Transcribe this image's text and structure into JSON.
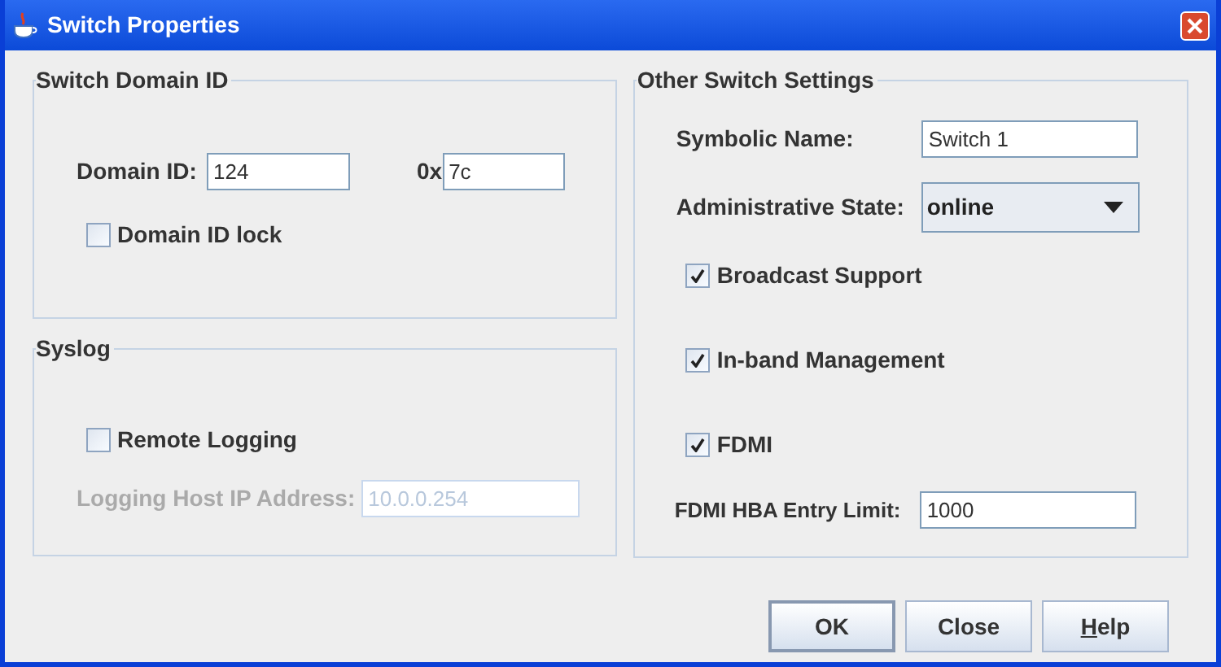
{
  "window": {
    "title": "Switch Properties"
  },
  "domain_group": {
    "title": "Switch Domain ID",
    "domain_id_label": "Domain ID:",
    "domain_id": "124",
    "hex_label": "0x",
    "hex_value": "7c",
    "lock": {
      "label": "Domain ID lock",
      "checked": false
    }
  },
  "syslog_group": {
    "title": "Syslog",
    "remote_logging": {
      "label": "Remote Logging",
      "checked": false
    },
    "host_label": "Logging Host IP Address:",
    "host_value": "10.0.0.254",
    "host_disabled": true
  },
  "other_group": {
    "title": "Other Switch Settings",
    "symbolic_name_label": "Symbolic Name:",
    "symbolic_name": "Switch 1",
    "admin_state_label": "Administrative State:",
    "admin_state": "online",
    "options": [
      {
        "label": "Broadcast Support",
        "checked": true
      },
      {
        "label": "In-band Management",
        "checked": true
      },
      {
        "label": "FDMI",
        "checked": true
      }
    ],
    "fdmi_limit_label": "FDMI HBA Entry Limit:",
    "fdmi_limit": "1000"
  },
  "buttons": [
    {
      "label": "OK",
      "default": true,
      "mnemonic": false
    },
    {
      "label": "Close",
      "default": false,
      "mnemonic": false
    },
    {
      "label": "Help",
      "default": false,
      "mnemonic": true
    }
  ]
}
